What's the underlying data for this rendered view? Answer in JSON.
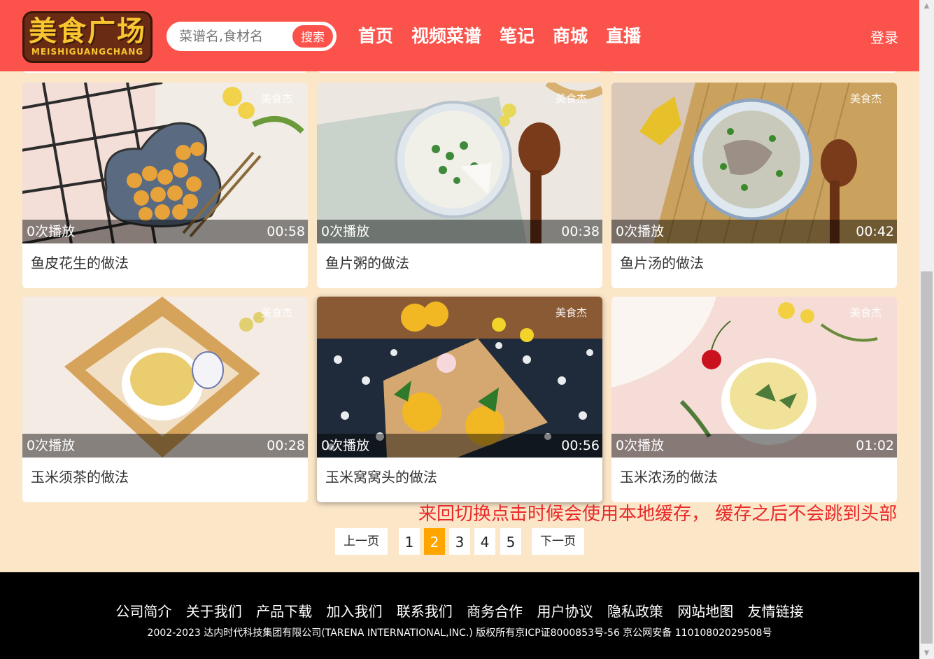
{
  "header": {
    "logo_cn": "美食广场",
    "logo_en": "MEISHIGUANGCHANG",
    "search_placeholder": "菜谱名,食材名",
    "search_button": "搜索",
    "nav": [
      "首页",
      "视频菜谱",
      "笔记",
      "商城",
      "直播"
    ],
    "login": "登录"
  },
  "videos": [
    {
      "title": "鱼皮花生的做法",
      "plays": "0次播放",
      "duration": "00:58"
    },
    {
      "title": "鱼片粥的做法",
      "plays": "0次播放",
      "duration": "00:38"
    },
    {
      "title": "鱼片汤的做法",
      "plays": "0次播放",
      "duration": "00:42"
    },
    {
      "title": "玉米须茶的做法",
      "plays": "0次播放",
      "duration": "00:28"
    },
    {
      "title": "玉米窝窝头的做法",
      "plays": "0次播放",
      "duration": "00:56"
    },
    {
      "title": "玉米浓汤的做法",
      "plays": "0次播放",
      "duration": "01:02"
    }
  ],
  "watermark": "美食杰",
  "annotation": "来回切换点击时候会使用本地缓存， 缓存之后不会跳到头部",
  "pagination": {
    "prev": "上一页",
    "next": "下一页",
    "pages": [
      "1",
      "2",
      "3",
      "4",
      "5"
    ],
    "current": "2"
  },
  "footer": {
    "links": [
      "公司简介",
      "关于我们",
      "产品下载",
      "加入我们",
      "联系我们",
      "商务合作",
      "用户协议",
      "隐私政策",
      "网站地图",
      "友情链接"
    ],
    "copyright": "2002-2023 达内时代科技集团有限公司(TARENA INTERNATIONAL,INC.) 版权所有京ICP证8000853号-56 京公网安备 11010802029508号"
  },
  "colors": {
    "header_bg": "#fb534b",
    "page_bg": "#fbe6c8",
    "active_page": "#ffa500",
    "annotation": "#e82a2a"
  }
}
